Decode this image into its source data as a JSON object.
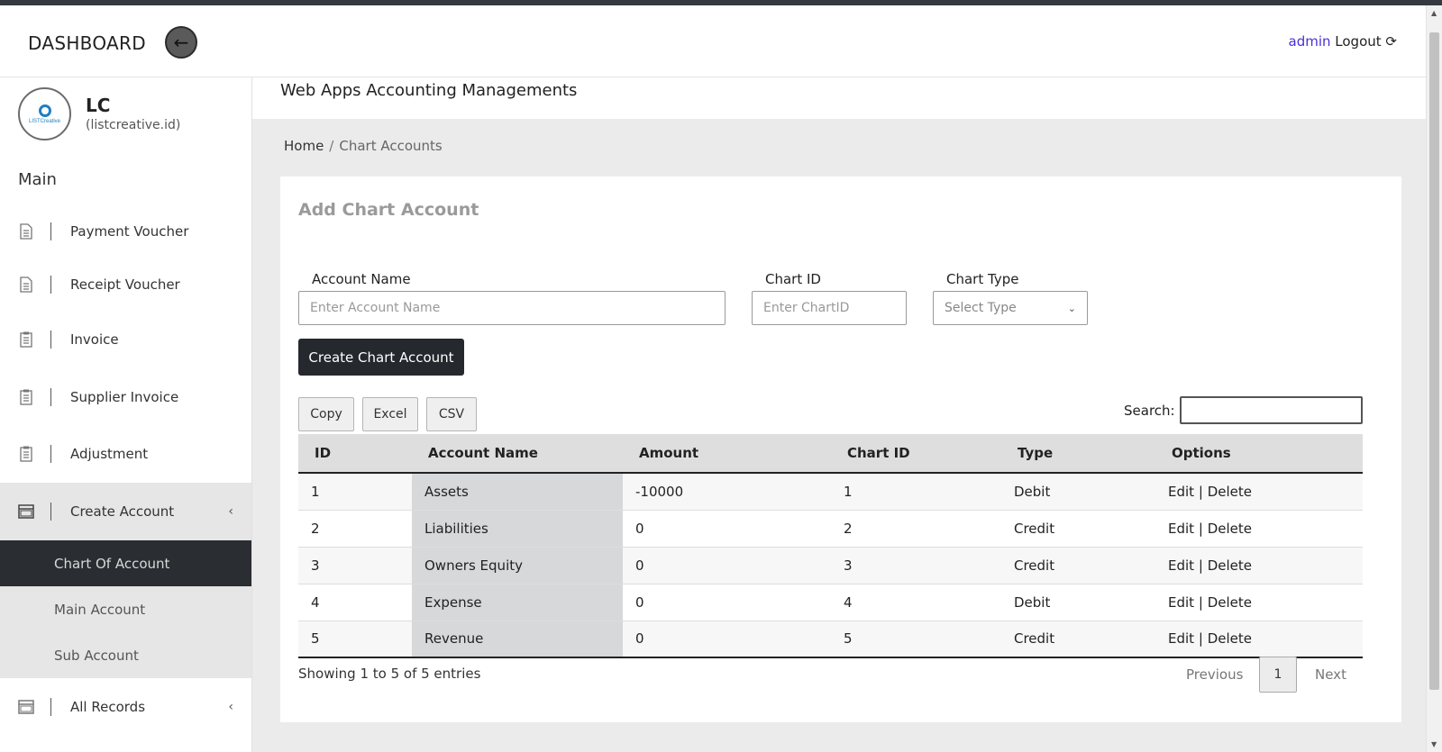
{
  "header": {
    "brand": "DASHBOARD",
    "back_icon": "←",
    "user": "admin",
    "logout": "Logout",
    "logout_icon": "⟳"
  },
  "sidebar": {
    "org_name": "LC",
    "org_domain": "(listcreative.id)",
    "logo_text": "LISTCreative",
    "heading": "Main",
    "items": [
      {
        "label": "Payment Voucher",
        "icon": "document-icon"
      },
      {
        "label": "Receipt Voucher",
        "icon": "document-icon"
      },
      {
        "label": "Invoice",
        "icon": "clipboard-icon"
      },
      {
        "label": "Supplier Invoice",
        "icon": "clipboard-icon"
      },
      {
        "label": "Adjustment",
        "icon": "clipboard-icon"
      },
      {
        "label": "Create Account",
        "icon": "window-icon",
        "chevron": "‹"
      },
      {
        "label": "All Records",
        "icon": "window-icon",
        "chevron": "‹"
      }
    ],
    "sub_items": [
      {
        "label": "Chart Of Account"
      },
      {
        "label": "Main Account"
      },
      {
        "label": "Sub Account"
      }
    ]
  },
  "main": {
    "page_title": "Web Apps Accounting Managements",
    "breadcrumb": {
      "home": "Home",
      "separator": "/",
      "current": "Chart Accounts"
    },
    "card_title": "Add Chart Account",
    "form": {
      "account_name_label": "Account Name",
      "account_name_placeholder": "Enter Account Name",
      "chart_id_label": "Chart ID",
      "chart_id_placeholder": "Enter ChartID",
      "chart_type_label": "Chart Type",
      "chart_type_selected": "Select Type",
      "submit_label": "Create Chart Account"
    },
    "toolbar": {
      "copy": "Copy",
      "excel": "Excel",
      "csv": "CSV",
      "search_label": "Search:"
    },
    "table": {
      "columns": [
        "ID",
        "Account Name",
        "Amount",
        "Chart ID",
        "Type",
        "Options"
      ],
      "rows": [
        {
          "id": "1",
          "name": "Assets",
          "amount": "-10000",
          "chart_id": "1",
          "type": "Debit",
          "edit": "Edit",
          "sep": "|",
          "delete": "Delete"
        },
        {
          "id": "2",
          "name": "Liabilities",
          "amount": "0",
          "chart_id": "2",
          "type": "Credit",
          "edit": "Edit",
          "sep": "|",
          "delete": "Delete"
        },
        {
          "id": "3",
          "name": "Owners Equity",
          "amount": "0",
          "chart_id": "3",
          "type": "Credit",
          "edit": "Edit",
          "sep": "|",
          "delete": "Delete"
        },
        {
          "id": "4",
          "name": "Expense",
          "amount": "0",
          "chart_id": "4",
          "type": "Debit",
          "edit": "Edit",
          "sep": "|",
          "delete": "Delete"
        },
        {
          "id": "5",
          "name": "Revenue",
          "amount": "0",
          "chart_id": "5",
          "type": "Credit",
          "edit": "Edit",
          "sep": "|",
          "delete": "Delete"
        }
      ]
    },
    "footer": {
      "info": "Showing 1 to 5 of 5 entries",
      "previous": "Previous",
      "page": "1",
      "next": "Next"
    }
  },
  "colors": {
    "accent_user": "#4b2fd6",
    "dark_button": "#25282c",
    "active_sub": "#2a2d31"
  }
}
